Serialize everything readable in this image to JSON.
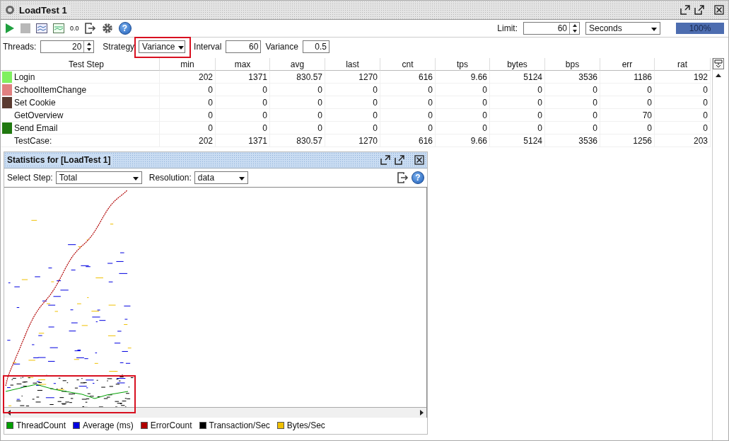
{
  "window": {
    "title": "LoadTest 1"
  },
  "toolbar": {
    "rate_label": "0.0",
    "help_glyph": "?"
  },
  "limit": {
    "label": "Limit:",
    "value": "60",
    "unit": "Seconds"
  },
  "progress": {
    "level": 1,
    "text": "100%"
  },
  "params": {
    "threads_label": "Threads:",
    "threads": "20",
    "strategy_label": "Strategy",
    "strategy": "Variance",
    "interval_label": "Interval",
    "interval": "60",
    "variance_label": "Variance",
    "variance": "0.5"
  },
  "table": {
    "columns": [
      "Test Step",
      "min",
      "max",
      "avg",
      "last",
      "cnt",
      "tps",
      "bytes",
      "bps",
      "err",
      "rat"
    ],
    "rows": [
      {
        "color": "#80f060",
        "cells": [
          "Login",
          "202",
          "1371",
          "830.57",
          "1270",
          "616",
          "9.66",
          "5124",
          "3536",
          "1186",
          "192"
        ]
      },
      {
        "color": "#e08080",
        "cells": [
          "SchoolItemChange",
          "0",
          "0",
          "0",
          "0",
          "0",
          "0",
          "0",
          "0",
          "0",
          "0"
        ]
      },
      {
        "color": "#5a3a30",
        "cells": [
          "Set Cookie",
          "0",
          "0",
          "0",
          "0",
          "0",
          "0",
          "0",
          "0",
          "0",
          "0"
        ]
      },
      {
        "cells": [
          "GetOverview",
          "0",
          "0",
          "0",
          "0",
          "0",
          "0",
          "0",
          "0",
          "70",
          "0"
        ]
      },
      {
        "color": "#207810",
        "cells": [
          "Send Email",
          "0",
          "0",
          "0",
          "0",
          "0",
          "0",
          "0",
          "0",
          "0",
          "0"
        ]
      },
      {
        "cells": [
          "TestCase:",
          "202",
          "1371",
          "830.57",
          "1270",
          "616",
          "9.66",
          "5124",
          "3536",
          "1256",
          "203"
        ]
      }
    ]
  },
  "statistics": {
    "title": "Statistics for [LoadTest 1]",
    "step_label": "Select Step:",
    "step": "Total",
    "resolution_label": "Resolution:",
    "resolution": "data",
    "help_glyph": "?",
    "legend": [
      {
        "label": "ThreadCount",
        "color": "#00a000"
      },
      {
        "label": "Average (ms)",
        "color": "#0000e0"
      },
      {
        "label": "ErrorCount",
        "color": "#b00000"
      },
      {
        "label": "Transaction/Sec",
        "color": "#000000"
      },
      {
        "label": "Bytes/Sec",
        "color": "#f0c000"
      }
    ]
  }
}
